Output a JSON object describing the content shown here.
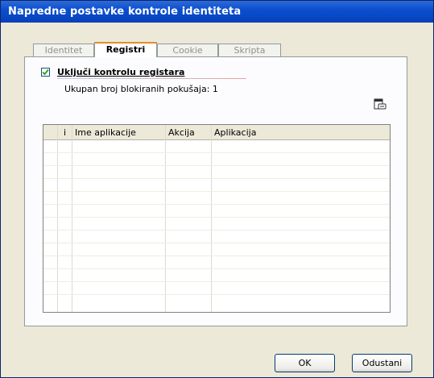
{
  "window": {
    "title": "Napredne postavke kontrole identiteta"
  },
  "tabs": [
    {
      "label": "Identitet"
    },
    {
      "label": "Registri"
    },
    {
      "label": "Cookie"
    },
    {
      "label": "Skripta"
    }
  ],
  "registry": {
    "enable_label": "Uključi kontrolu registara",
    "enabled": true,
    "blocked_count_text": "Ukupan broj blokiranih pokušaja: 1",
    "export_icon": "export-icon"
  },
  "table": {
    "columns": [
      "i",
      "Ime aplikacije",
      "Akcija",
      "Aplikacija"
    ],
    "rows": []
  },
  "buttons": {
    "ok": "OK",
    "cancel": "Odustani"
  },
  "colors": {
    "titlebar": "#0a4fd0",
    "active_tab_accent": "#e68b2c",
    "dialog_bg": "#ece9d8"
  }
}
